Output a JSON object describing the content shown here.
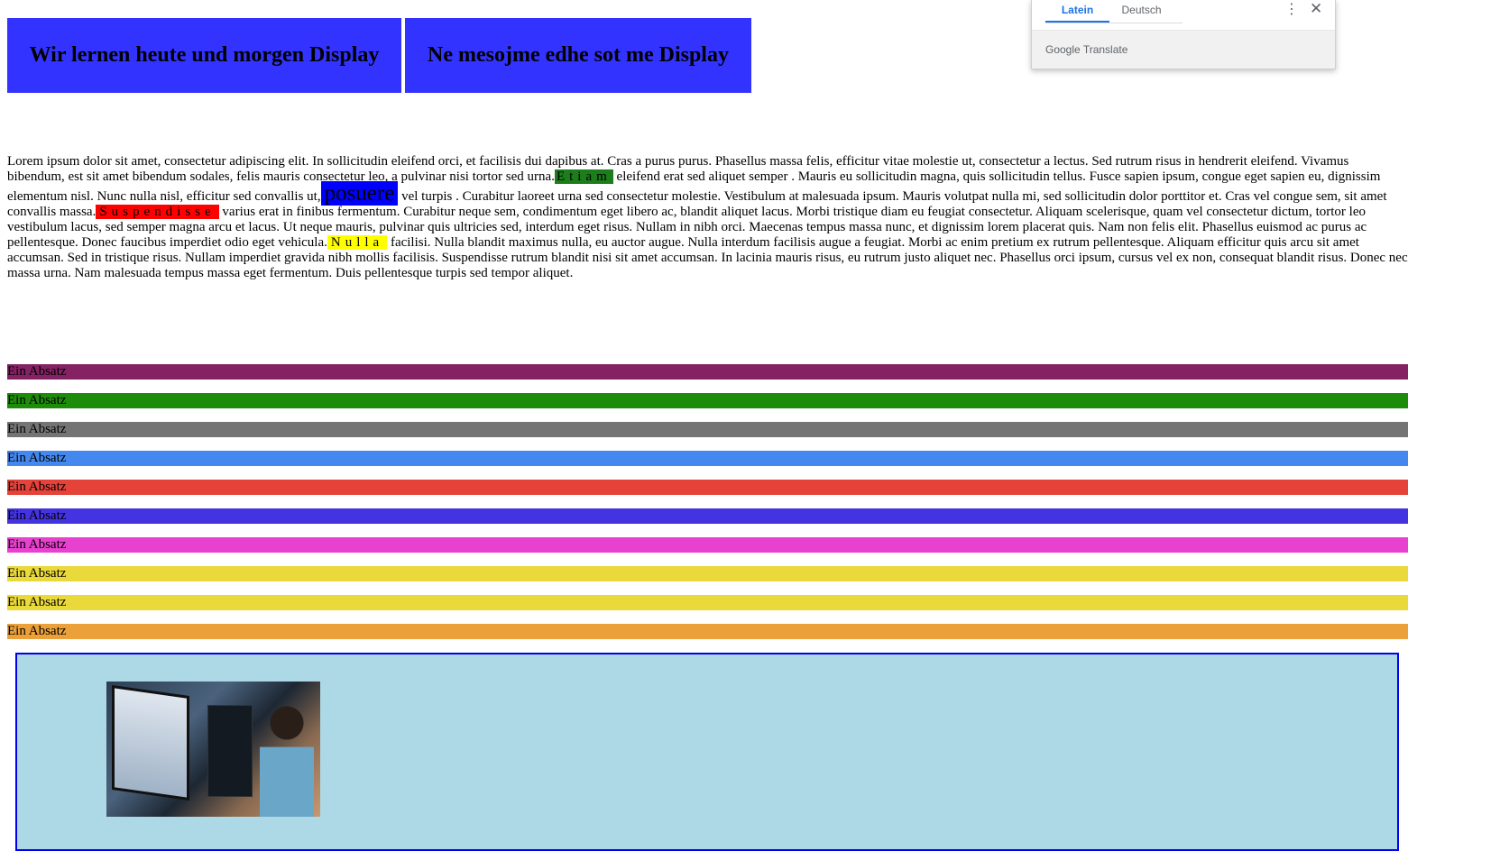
{
  "headers": {
    "first": "Wir lernen heute und morgen Display",
    "second": "Ne mesojme edhe sot me Display",
    "color": "#3333ff"
  },
  "lorem": {
    "p1": "Lorem ipsum dolor sit amet, consectetur adipiscing elit. In sollicitudin eleifend orci, et facilisis dui dapibus at. Cras a purus purus. Phasellus massa felis, efficitur vitae molestie ut, consectetur a lectus. Sed rutrum risus in hendrerit eleifend. Vivamus bibendum, est sit amet bibendum sodales, felis mauris consectetur leo, a pulvinar nisi tortor sed urna.",
    "h1": "Etiam",
    "p2": " eleifend erat sed aliquet semper . Mauris eu sollicitudin magna, quis sollicitudin tellus. Fusce sapien ipsum, congue eget sapien eu, dignissim elementum nisl. Nunc nulla nisl, efficitur sed convallis ut,",
    "h2": "posuere",
    "p3": " vel turpis . Curabitur laoreet urna sed consectetur molestie. Vestibulum at malesuada ipsum. Mauris volutpat nulla mi, sed sollicitudin dolor porttitor et. Cras vel congue sem, sit amet convallis massa.",
    "h3": "Suspendisse",
    "p4": " varius erat in finibus fermentum. Curabitur neque sem, condimentum eget libero ac, blandit aliquet lacus. Morbi tristique diam eu feugiat consectetur. Aliquam scelerisque, quam vel consectetur dictum, tortor leo vestibulum lacus, sed semper magna arcu et lacus. Ut neque mauris, pulvinar quis ultricies sed, interdum eget risus. Nullam in nibh orci. Maecenas tempus massa nunc, et dignissim lorem placerat quis. Nam non felis elit. Phasellus euismod ac purus ac pellentesque. Donec faucibus imperdiet odio eget vehicula.",
    "h4": "Nulla",
    "p5": " facilisi. Nulla blandit maximus nulla, eu auctor augue. Nulla interdum facilisis augue a feugiat. Morbi ac enim pretium ex rutrum pellentesque. Aliquam efficitur quis arcu sit amet accumsan. Sed in tristique risus. Nullam imperdiet gravida nibh mollis facilisis. Suspendisse rutrum blandit nisi sit amet accumsan. In lacinia mauris risus, eu rutrum justo aliquet nec. Phasellus orci ipsum, cursus vel ex non, consequat blandit risus. Donec nec massa urna. Nam malesuada tempus massa eget fermentum. Duis pellentesque turpis sed tempor aliquet."
  },
  "absaetze": [
    {
      "label": "Ein Absatz",
      "color": "#852264"
    },
    {
      "label": "Ein Absatz",
      "color": "#1e8c0b"
    },
    {
      "label": "Ein Absatz",
      "color": "#747474"
    },
    {
      "label": "Ein Absatz",
      "color": "#4488ef"
    },
    {
      "label": "Ein Absatz",
      "color": "#e5433a"
    },
    {
      "label": "Ein Absatz",
      "color": "#4433e0"
    },
    {
      "label": "Ein Absatz",
      "color": "#e840cf"
    },
    {
      "label": "Ein Absatz",
      "color": "#ead93a"
    },
    {
      "label": "Ein Absatz",
      "color": "#ead93a"
    },
    {
      "label": "Ein Absatz",
      "color": "#eba03a"
    }
  ],
  "translate": {
    "tab_latin": "Latein",
    "tab_german": "Deutsch",
    "more_icon": "⋮",
    "close_icon": "✕",
    "brand_google": "Google",
    "brand_translate": "Translate"
  },
  "gallery": {
    "background": "#add8e6",
    "border": "#0000ee"
  }
}
